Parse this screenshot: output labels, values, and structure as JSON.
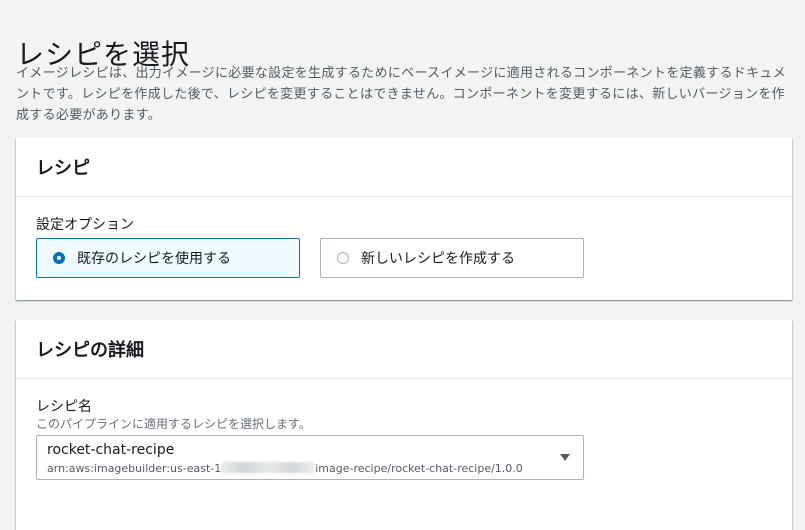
{
  "page": {
    "title": "レシピを選択",
    "description": "イメージレシピは、出力イメージに必要な設定を生成するためにベースイメージに適用されるコンポーネントを定義するドキュメントです。レシピを作成した後で、レシピを変更することはできません。コンポーネントを変更するには、新しいバージョンを作成する必要があります。"
  },
  "recipe_panel": {
    "header": "レシピ",
    "config_label": "設定オプション",
    "options": [
      {
        "label": "既存のレシピを使用する",
        "selected": true
      },
      {
        "label": "新しいレシピを作成する",
        "selected": false
      }
    ]
  },
  "details_panel": {
    "header": "レシピの詳細",
    "name_label": "レシピ名",
    "name_description": "このパイプラインに適用するレシピを選択します。",
    "selected_recipe": "rocket-chat-recipe",
    "arn_prefix": "arn:aws:imagebuilder:us-east-1",
    "arn_suffix": "image-recipe/rocket-chat-recipe/1.0.0"
  },
  "colors": {
    "accent": "#0073bb",
    "selected_bg": "#f1faff",
    "page_bg": "#f2f3f3"
  }
}
